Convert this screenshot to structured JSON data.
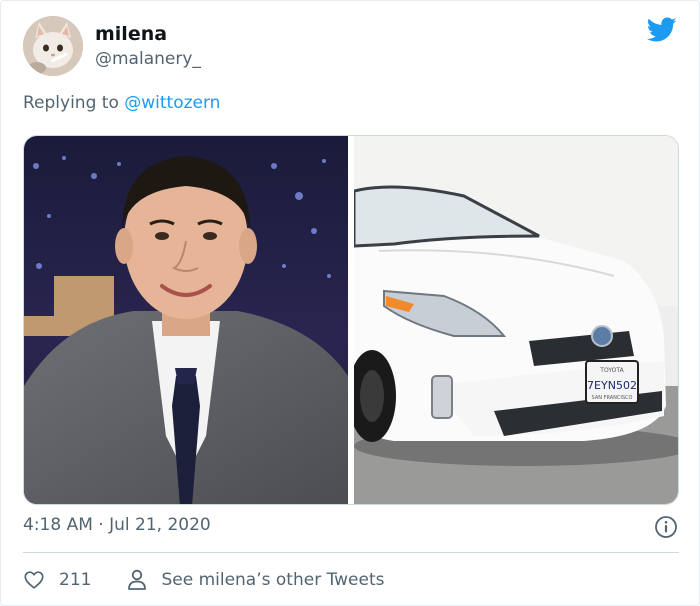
{
  "tweet": {
    "user": {
      "display_name": "milena",
      "handle": "@malanery_"
    },
    "replying_prefix": "Replying to ",
    "replying_to": "@wittozern",
    "timestamp": "4:18 AM · Jul 21, 2020",
    "like_count": "211",
    "other_tweets_label": "See milena’s other Tweets"
  },
  "car_plate": {
    "brand": "TOYOTA",
    "number": "7EYN502",
    "city": "SAN FRANCISCO"
  },
  "colors": {
    "twitter_blue": "#1d9bf0",
    "secondary_text": "#536471",
    "divider": "#cfd9de"
  },
  "icons": {
    "brand": "twitter-bird-icon",
    "info": "info-icon",
    "like": "heart-icon",
    "profile": "person-icon"
  }
}
